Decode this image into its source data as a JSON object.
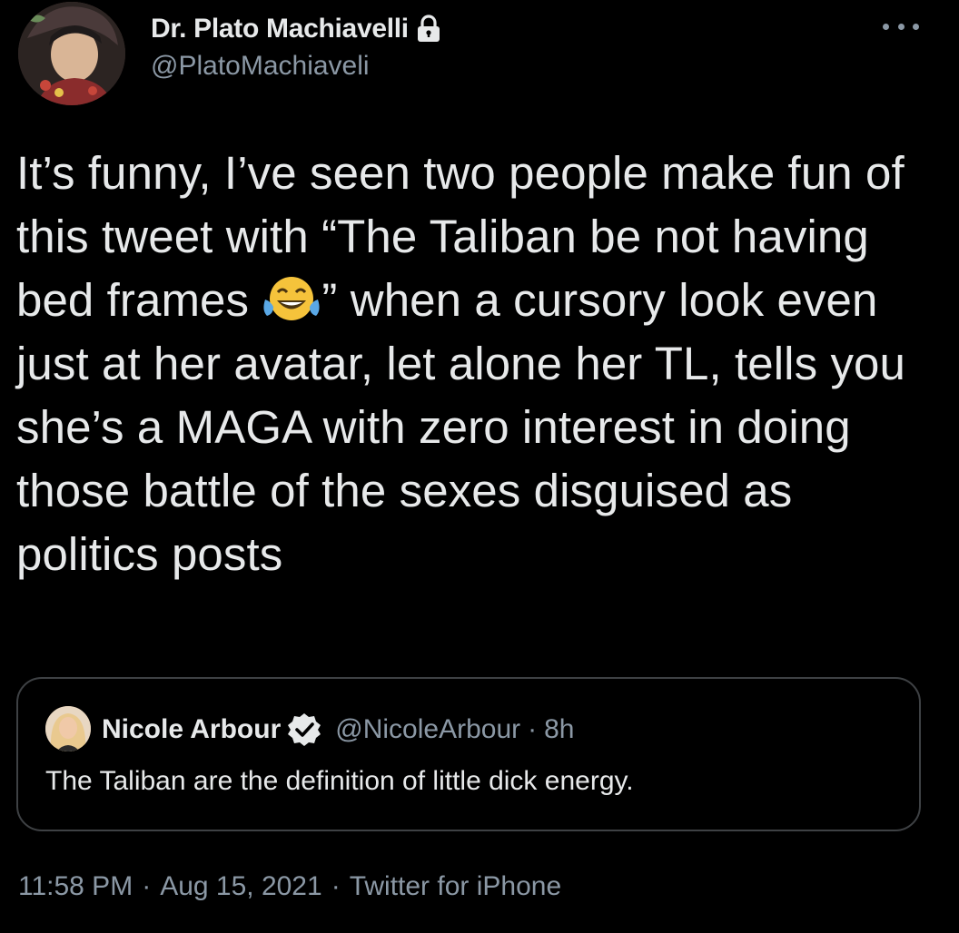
{
  "author": {
    "display_name": "Dr. Plato Machiavelli",
    "handle": "@PlatoMachiaveli",
    "protected_icon": "lock-icon",
    "avatar_icon": "avatar-image"
  },
  "menu": {
    "more_icon": "more-horizontal-icon"
  },
  "tweet": {
    "text_before_emoji": "It’s funny, I’ve seen two people make fun of this tweet with “The Taliban be not having bed frames ",
    "emoji": "face-with-tears-of-joy-emoji",
    "text_after_emoji": "” when a cursory look even just at her avatar, let alone her TL, tells you she’s a MAGA with zero interest in doing those battle of the sexes disguised as politics posts"
  },
  "quote": {
    "display_name": "Nicole Arbour",
    "verified_icon": "verified-badge-icon",
    "handle": "@NicoleArbour",
    "separator": "·",
    "time": "8h",
    "text": "The Taliban are the definition of little dick energy."
  },
  "meta": {
    "time": "11:58 PM",
    "separator": "·",
    "date": "Aug 15, 2021",
    "source": "Twitter for iPhone"
  },
  "colors": {
    "background": "#000000",
    "primary_text": "#e7e9ea",
    "secondary_text": "#8b98a5",
    "border": "#3e4144",
    "emoji_yellow": "#f5c33b",
    "emoji_tears": "#5aa8e6"
  }
}
